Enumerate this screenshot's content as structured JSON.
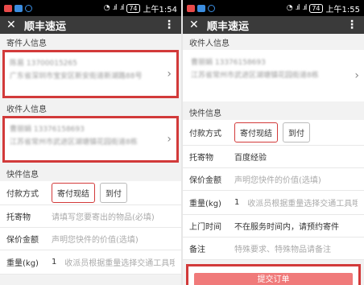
{
  "left": {
    "status": {
      "battery": "74",
      "time": "上午1:54"
    },
    "app": {
      "title": "顺丰速运"
    },
    "sender": {
      "title": "寄件人信息",
      "line1": "陈易  13700015265",
      "line2": "广东省深圳市宝安区新安街道新湖路88号"
    },
    "receiver": {
      "title": "收件人信息",
      "line1": "曹丽娟  13376158693",
      "line2": "江苏省常州市武进区湖塘镇花园街道8栋"
    },
    "shipment": {
      "title": "快件信息",
      "payment_label": "付款方式",
      "pay_option1": "寄付现结",
      "pay_option2": "到付",
      "item_label": "托寄物",
      "item_placeholder": "请填写您要寄出的物品(必填)",
      "insure_label": "保价金额",
      "insure_placeholder": "声明您快件的价值(选填)",
      "weight_label": "重量(kg)",
      "weight_value": "1",
      "weight_hint": "收派员根据重量选择交通工具哦"
    }
  },
  "right": {
    "status": {
      "battery": "74",
      "time": "上午1:55"
    },
    "app": {
      "title": "顺丰速运"
    },
    "receiver": {
      "title": "收件人信息",
      "line1": "曹丽娟  13376158693",
      "line2": "江苏省常州市武进区湖塘镇花园街道8栋"
    },
    "shipment": {
      "title": "快件信息",
      "payment_label": "付款方式",
      "pay_option1": "寄付现结",
      "pay_option2": "到付",
      "item_label": "托寄物",
      "item_value": "百度经验",
      "insure_label": "保价金额",
      "insure_placeholder": "声明您快件的价值(选填)",
      "weight_label": "重量(kg)",
      "weight_value": "1",
      "weight_hint": "收派员根据重量选择交通工具哦",
      "pickup_label": "上门时间",
      "pickup_value": "不在服务时间内，请预约寄件",
      "note_label": "备注",
      "note_placeholder": "特殊要求、特殊物品请备注"
    },
    "submit_label": "提交订单"
  }
}
